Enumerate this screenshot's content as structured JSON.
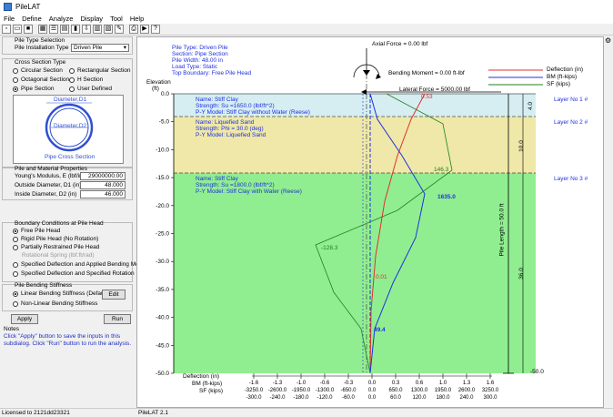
{
  "window": {
    "title": "PileLAT"
  },
  "menu": [
    "File",
    "Define",
    "Analyze",
    "Display",
    "Tool",
    "Help"
  ],
  "left": {
    "pile_type_header": "Pile Type Selection",
    "pile_install_label": "Pile Installation Type",
    "pile_install_value": "Driven Pile",
    "cross_section_header": "Cross Section Type",
    "cs_circular": "Circular Section",
    "cs_rect": "Rectangular Section",
    "cs_oct": "Octagonal Section",
    "cs_h": "H Section",
    "cs_pipe": "Pipe Section",
    "cs_user": "User Defined",
    "diag_d1": "Diameter,D1",
    "diag_d2": "Diameter,D2",
    "diag_caption": "Pipe Cross Section",
    "material_header": "Pile and Material Properties",
    "youngs_label": "Young's Modulus, E (lbf/in^2)",
    "youngs_value": "29000000.00",
    "outside_label": "Outside Diameter, D1 (in)",
    "outside_value": "48.000",
    "inside_label": "Inside Diameter, D2 (in)",
    "inside_value": "46.000",
    "boundary_header": "Boundary Conditions at Pile Head",
    "bc_free": "Free Pile Head",
    "bc_rigid": "Rigid Pile Head (No Rotation)",
    "bc_partial": "Partially Restrained Pile Head",
    "bc_rot_spring": "Rotational Spring (lbf.ft/rad)",
    "bc_spec_bm": "Specified Deflection and Applied Bending Moment",
    "bc_spec_rot": "Specified Deflection and Specified Rotation",
    "bending_header": "Pile Bending Stiffness",
    "bend_linear": "Linear Bending Stiffness (Default)",
    "bend_edit": "Edit",
    "bend_nonlinear": "Non-Linear Bending Stiffness",
    "apply": "Apply",
    "run": "Run",
    "notes_header": "Notes",
    "notes_line1": "Click \"Apply\" button to save the inputs in this",
    "notes_line2": "subdialog. Click \"Run\" button to run the analysis."
  },
  "plot": {
    "info": [
      "Pile Type: Driven Pile",
      "Section: Pipe Section",
      "Pile Width:  48.00 in",
      "Load Type: Static",
      "Top Boundary: Free Pile Head"
    ],
    "axial_force": "Axial Force = 0.00 lbf",
    "bending_moment": "Bending Moment = 0.00 ft-lbf",
    "lateral_force": "Lateral Force = 5000.00 lbf",
    "elevation_label": "Elevation",
    "elevation_unit": "(ft)",
    "y_ticks": [
      "0.0",
      "-5.0",
      "-10.0",
      "-15.0",
      "-20.0",
      "-25.0",
      "-30.0",
      "-35.0",
      "-40.0",
      "-45.0",
      "-50.0"
    ],
    "layers": [
      {
        "name": "Name: Stiff Clay",
        "strength": "Strength: Su =1650.0 (lbf/ft^2)",
        "model": "P-Y Model: Stiff Clay without Water (Reese)",
        "tag": "Layer No   1 #",
        "thick": "4.0",
        "color": "#d6eef2"
      },
      {
        "name": "Name: Liquefied Sand",
        "strength": "Strength: Phi =  30.0 (deg)",
        "model": "P-Y Model: Liquefied Sand",
        "tag": "Layer No   2 #",
        "thick": "10.0",
        "color": "#efe8a8"
      },
      {
        "name": "Name: Stiff Clay",
        "strength": "Strength: Su =1800.0 (lbf/ft^2)",
        "model": "P-Y Model: Stiff Clay with Water (Reese)",
        "tag": "Layer No   3 #",
        "thick": "36.0",
        "color": "#90ee90"
      }
    ],
    "pile_length": "Pile Length = 50.0 ft",
    "bottom_val": "-50.0",
    "legend": [
      {
        "name": "Deflection (in)",
        "color": "#e03030"
      },
      {
        "name": "BM (ft-kips)",
        "color": "#2030e0"
      },
      {
        "name": "SF (kips)",
        "color": "#208020"
      }
    ],
    "annotations": {
      "bm_max": "1635.0",
      "sf_pos": "146.3",
      "sf_neg": "-128.3",
      "defl_small": "0.01",
      "bm_low": "49.4",
      "top_val": "0.53"
    },
    "x_axis_labels": [
      "Deflection (in)",
      "BM (ft-kips)",
      "SF (kips)"
    ],
    "x_defl": [
      "-1.6",
      "-1.3",
      "-1.0",
      "-0.6",
      "-0.3",
      "0.0",
      "0.3",
      "0.6",
      "1.0",
      "1.3",
      "1.6"
    ],
    "x_bm": [
      "-3250.0",
      "-2600.0",
      "-1950.0",
      "-1300.0",
      "-650.0",
      "0.0",
      "650.0",
      "1300.0",
      "1950.0",
      "2600.0",
      "3250.0"
    ],
    "x_sf": [
      "-300.0",
      "-240.0",
      "-180.0",
      "-120.0",
      "-60.0",
      "0.0",
      "60.0",
      "120.0",
      "180.0",
      "240.0",
      "300.0"
    ]
  },
  "status": {
    "left": "Licensed to 2121dd23321",
    "right": "PileLAT 2.1"
  }
}
